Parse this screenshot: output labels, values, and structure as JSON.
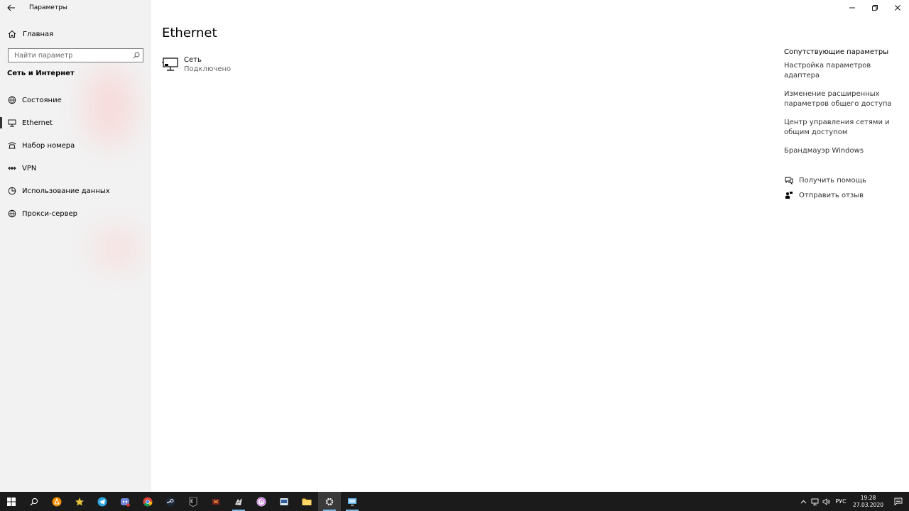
{
  "window": {
    "app_title": "Параметры",
    "controls": {
      "minimize": "—",
      "restore": "❐",
      "close": "✕"
    }
  },
  "sidebar": {
    "home_label": "Главная",
    "search_placeholder": "Найти параметр",
    "section_title": "Сеть и Интернет",
    "items": [
      {
        "label": "Состояние",
        "icon": "globe-status-icon"
      },
      {
        "label": "Ethernet",
        "icon": "ethernet-icon",
        "active": true
      },
      {
        "label": "Набор номера",
        "icon": "dialup-icon"
      },
      {
        "label": "VPN",
        "icon": "vpn-icon"
      },
      {
        "label": "Использование данных",
        "icon": "data-usage-icon"
      },
      {
        "label": "Прокси-сервер",
        "icon": "globe-icon"
      }
    ]
  },
  "main": {
    "title": "Ethernet",
    "network": {
      "name": "Сеть",
      "status": "Подключено"
    },
    "related": {
      "heading": "Сопутствующие параметры",
      "links": [
        "Настройка параметров адаптера",
        "Изменение расширенных параметров общего доступа",
        "Центр управления сетями и общим доступом",
        "Брандмауэр Windows"
      ]
    },
    "help": {
      "get_help": "Получить помощь",
      "feedback": "Отправить отзыв"
    }
  },
  "taskbar": {
    "apps": [
      "start",
      "search",
      "avast",
      "star-app",
      "telegram",
      "discord",
      "chrome",
      "steam",
      "epic-games",
      "app-red",
      "app-game",
      "itunes",
      "app-blue",
      "file-explorer",
      "settings",
      "remote-desktop"
    ],
    "tray": {
      "language": "РУС",
      "time": "19:28",
      "date": "27.03.2020"
    }
  }
}
